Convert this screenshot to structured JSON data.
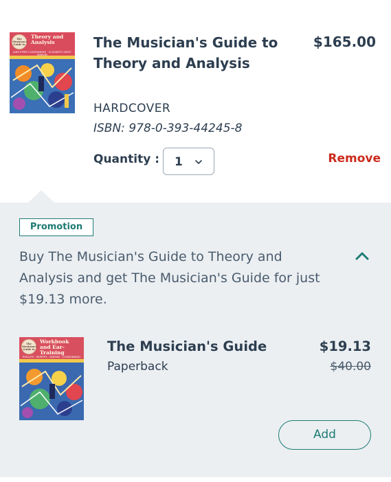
{
  "cart_item": {
    "title": "The Musician's Guide to Theory and Analysis",
    "price": "$165.00",
    "format": "HARDCOVER",
    "isbn": "ISBN: 978-0-393-44245-8",
    "quantity_label": "Quantity :",
    "quantity_value": "1",
    "remove_label": "Remove",
    "cover": {
      "title": "Theory and Analysis",
      "badge": "The Musician's Guide to",
      "subtitle": "JANE PIPER CLENDINNING · ELIZABETH WEST MARVIN"
    }
  },
  "promotion": {
    "badge": "Promotion",
    "description": "Buy The Musician's Guide to Theory and Analysis and get The Musician's Guide for just $19.13 more.",
    "item": {
      "title": "The Musician's Guide",
      "format": "Paperback",
      "price": "$19.13",
      "original_price": "$40.00",
      "add_label": "Add",
      "cover": {
        "title": "Workbook and Ear-Training",
        "badge": "The Musician's Guide to",
        "subtitle": "PHILLIPS · MURPHY · MARVIN · CLENDINNING"
      }
    }
  },
  "colors": {
    "text_primary": "#2d3e50",
    "remove": "#cc2b1d",
    "accent": "#1e7b74",
    "panel_bg": "#ebeff2"
  },
  "icons": {
    "quantity_dropdown": "chevron-down-icon",
    "collapse": "chevron-up-icon"
  }
}
